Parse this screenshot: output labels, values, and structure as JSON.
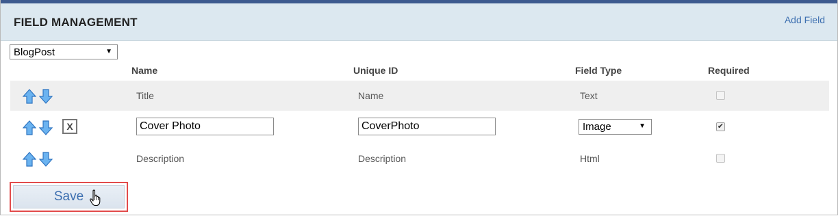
{
  "header": {
    "title": "FIELD MANAGEMENT",
    "add_field_label": "Add Field"
  },
  "content_type_select": {
    "selected": "BlogPost"
  },
  "columns": {
    "name": "Name",
    "unique_id": "Unique ID",
    "field_type": "Field Type",
    "required": "Required"
  },
  "rows": [
    {
      "name": "Title",
      "unique_id": "Name",
      "field_type": "Text",
      "required": false,
      "editing": false
    },
    {
      "name": "Cover Photo",
      "unique_id": "CoverPhoto",
      "field_type": "Image",
      "required": true,
      "editing": true,
      "delete_label": "X"
    },
    {
      "name": "Description",
      "unique_id": "Description",
      "field_type": "Html",
      "required": false,
      "editing": false
    }
  ],
  "save_label": "Save",
  "icons": {
    "move_up": "arrow-up-icon",
    "move_down": "arrow-down-icon",
    "pointer": "hand-pointer-icon"
  },
  "colors": {
    "accent": "#3d6fb0",
    "header_bg": "#dce8f0",
    "top_bar": "#3d5a8f",
    "highlight": "#e24b4b"
  }
}
